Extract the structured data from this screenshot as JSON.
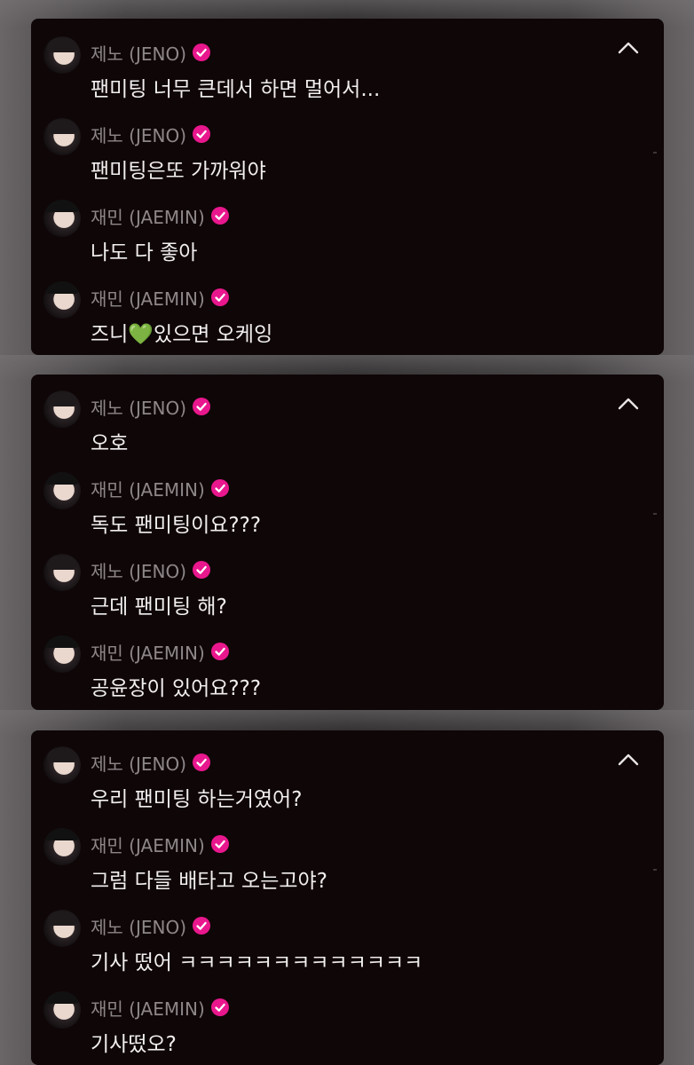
{
  "colors": {
    "panel_bg": "#0f0607",
    "name_text": "#8d8789",
    "message_text": "#f1eeef",
    "badge": "#e9178d"
  },
  "icons": {
    "verified": "verified-badge-icon",
    "collapse": "chevron-up-icon",
    "avatar": "profile-avatar"
  },
  "panels": [
    {
      "messages": [
        {
          "name": "제노 (JENO)",
          "text": "팬미팅 너무 큰데서 하면 멀어서..."
        },
        {
          "name": "제노 (JENO)",
          "text": "팬미팅은또 가까워야"
        },
        {
          "name": "재민 (JAEMIN)",
          "text": "나도 다 좋아"
        },
        {
          "name": "재민 (JAEMIN)",
          "text_before": "즈니",
          "emoji": "💚",
          "text_after": "있으면 오케잉"
        }
      ]
    },
    {
      "messages": [
        {
          "name": "제노 (JENO)",
          "text": "오호"
        },
        {
          "name": "재민 (JAEMIN)",
          "text": "독도 팬미팅이요???"
        },
        {
          "name": "제노 (JENO)",
          "text": "근데 팬미팅 해?"
        },
        {
          "name": "재민 (JAEMIN)",
          "text": "공윤장이 있어요???"
        }
      ]
    },
    {
      "messages": [
        {
          "name": "제노 (JENO)",
          "text": "우리 팬미팅 하는거였어?"
        },
        {
          "name": "재민 (JAEMIN)",
          "text": "그럼 다들 배타고 오는고야?"
        },
        {
          "name": "제노 (JENO)",
          "text": "기사 떴어 ㅋㅋㅋㅋㅋㅋㅋㅋㅋㅋㅋㅋㅋ"
        },
        {
          "name": "재민 (JAEMIN)",
          "text": "기사떴오?"
        }
      ]
    }
  ]
}
